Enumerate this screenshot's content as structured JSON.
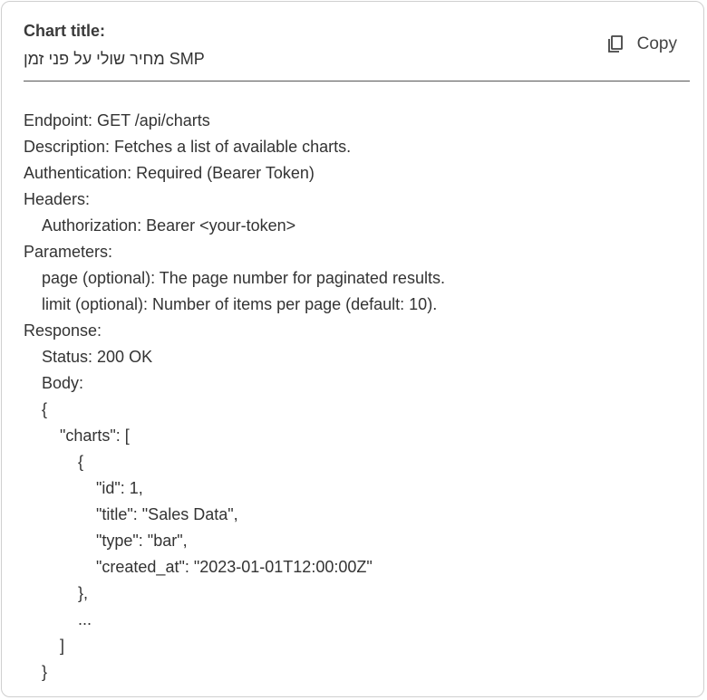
{
  "header": {
    "title_label": "Chart title:",
    "title_value": "מחיר שולי על פני זמן SMP",
    "copy_label": "Copy",
    "copy_icon": "copy-icon"
  },
  "content": {
    "lines": [
      {
        "text": "Endpoint: GET /api/charts",
        "indent": 0
      },
      {
        "text": "Description: Fetches a list of available charts.",
        "indent": 0
      },
      {
        "text": "Authentication: Required (Bearer Token)",
        "indent": 0
      },
      {
        "text": "Headers:",
        "indent": 0
      },
      {
        "text": "Authorization: Bearer <your-token>",
        "indent": 1
      },
      {
        "text": "Parameters:",
        "indent": 0
      },
      {
        "text": "page (optional): The page number for paginated results.",
        "indent": 1
      },
      {
        "text": "limit (optional): Number of items per page (default: 10).",
        "indent": 1
      },
      {
        "text": "Response:",
        "indent": 0
      },
      {
        "text": "Status: 200 OK",
        "indent": 1
      },
      {
        "text": "Body:",
        "indent": 1
      },
      {
        "text": "{",
        "indent": 1
      },
      {
        "text": "\"charts\": [",
        "indent": 2
      },
      {
        "text": "{",
        "indent": 3
      },
      {
        "text": "\"id\": 1,",
        "indent": 4
      },
      {
        "text": "\"title\": \"Sales Data\",",
        "indent": 4
      },
      {
        "text": "\"type\": \"bar\",",
        "indent": 4
      },
      {
        "text": "\"created_at\": \"2023-01-01T12:00:00Z\"",
        "indent": 4
      },
      {
        "text": "},",
        "indent": 3
      },
      {
        "text": "...",
        "indent": 3
      },
      {
        "text": "]",
        "indent": 2
      },
      {
        "text": "}",
        "indent": 1
      }
    ]
  }
}
